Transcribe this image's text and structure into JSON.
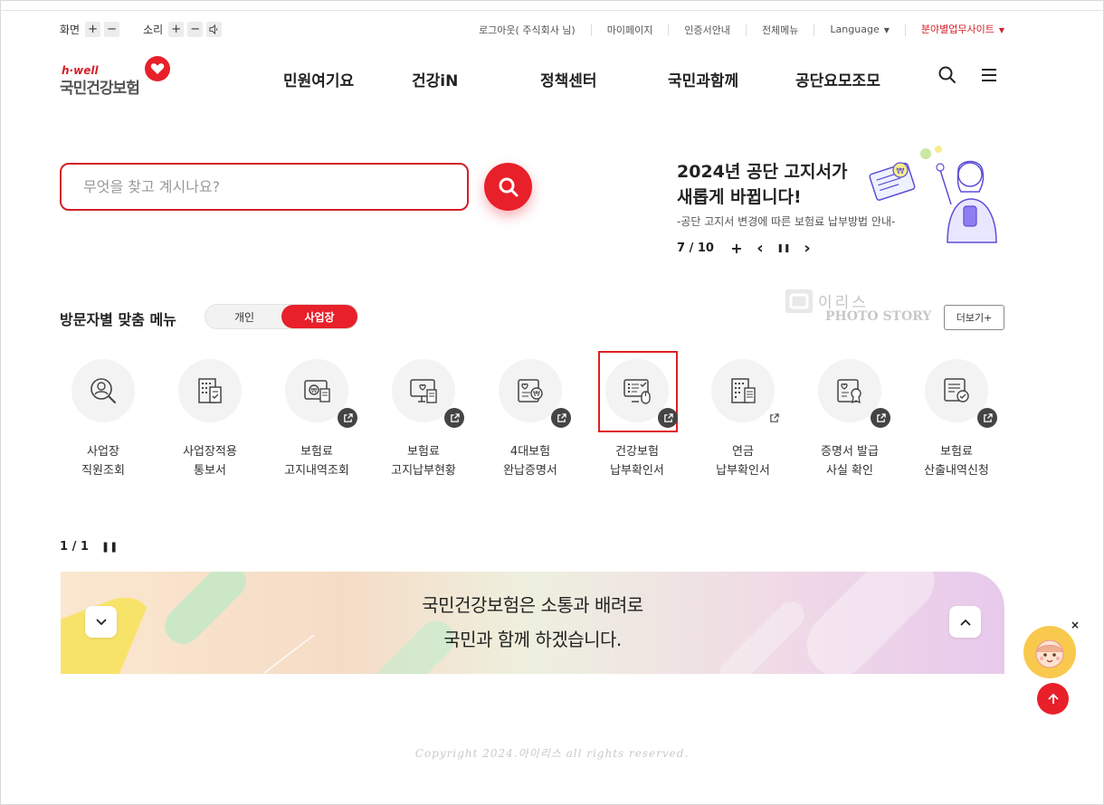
{
  "util": {
    "screen_label": "화면",
    "sound_label": "소리",
    "plus": "+",
    "minus": "−",
    "speaker": "🔈",
    "links": [
      "로그아웃( 주식회사 님)",
      "마이페이지",
      "인증서안내",
      "전체메뉴",
      "Language",
      "분야별업무사이트"
    ]
  },
  "logo": {
    "small": "h·well",
    "name": "국민건강보험"
  },
  "gnb": [
    "민원여기요",
    "건강iN",
    "정책센터",
    "국민과함께",
    "공단요모조모"
  ],
  "search": {
    "placeholder": "무엇을 찾고 계시나요?"
  },
  "notice": {
    "title_1": "2024년 공단 고지서가",
    "title_2": "새롭게 바뀝니다!",
    "subtitle": "-공단 고지서 변경에 따른 보험료 납부방법 안내-",
    "page": "7 / 10",
    "plus": "+",
    "prev": "‹",
    "pause": "❚❚",
    "next": "›"
  },
  "visitor_menu": {
    "title": "방문자별 맞춤 메뉴",
    "tab_personal": "개인",
    "tab_business": "사업장",
    "more": "더보기+",
    "watermark_1": "이리스",
    "watermark_2": "PHOTO STORY",
    "items": [
      {
        "line1": "사업장",
        "line2": "직원조회",
        "icon": "user-search-icon"
      },
      {
        "line1": "사업장적용",
        "line2": "통보서",
        "icon": "document-building-icon"
      },
      {
        "line1": "보험료",
        "line2": "고지내역조회",
        "icon": "won-document-icon"
      },
      {
        "line1": "보험료",
        "line2": "고지납부현황",
        "icon": "monitor-heart-icon"
      },
      {
        "line1": "4대보험",
        "line2": "완납증명서",
        "icon": "heart-won-icon"
      },
      {
        "line1": "건강보험",
        "line2": "납부확인서",
        "icon": "monitor-mouse-icon"
      },
      {
        "line1": "연금",
        "line2": "납부확인서",
        "icon": "building-document-icon"
      },
      {
        "line1": "증명서 발급",
        "line2": "사실 확인",
        "icon": "certificate-icon"
      },
      {
        "line1": "보험료",
        "line2": "산출내역신청",
        "icon": "document-check-icon"
      }
    ]
  },
  "pager": {
    "page": "1 / 1",
    "pause": "❚❚"
  },
  "slogan": {
    "line1": "국민건강보험은 소통과 배려로",
    "line2": "국민과 함께 하겠습니다."
  },
  "floating": {
    "close": "×"
  },
  "footer": {
    "copyright": "Copyright 2024.아이리스 all rights reserved."
  },
  "colors": {
    "brand_red": "#e8202a",
    "highlight": "#e02020"
  }
}
